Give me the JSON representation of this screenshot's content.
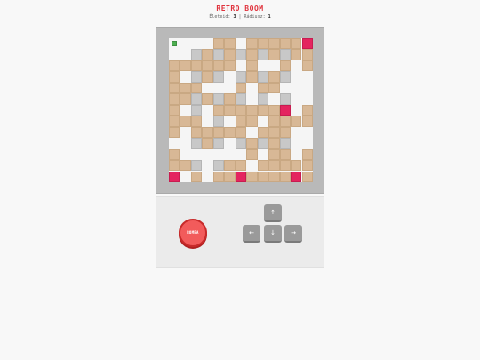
{
  "game": {
    "title": "RETRO BOOM",
    "stats": {
      "lives_label": "Életeid:",
      "lives_value": "3",
      "separator": "|",
      "radius_label": "Rádiusz:",
      "radius_value": "1"
    }
  },
  "board": {
    "size": 13,
    "legend": {
      "B": "breakable-block",
      "W": "wall",
      "E": "enemy",
      "P": "player",
      ".": "empty"
    },
    "colors": {
      "breakable": "#d8b896",
      "wall": "#c8c8c8",
      "enemy": "#e4245f",
      "player": "#4caf50",
      "floor": "#f5f5f5"
    },
    "rows": [
      "P...BB.BBBBBE",
      "..WBWBWBWBWBB",
      "BBBBBB.B..B.B",
      "B.WBW.WBWBW..",
      "BBB...B.BB...",
      "BBWBWBW.W.W..",
      "B.W.BBBBBBE.B",
      "BBB.W.BB.BBBB",
      "B.BBBBB.BBB..",
      "..WBW.WBWBW..",
      "B......B.BB.B",
      "BBW.WBB.BBBBB",
      "E.B.BBEBBBBEB"
    ]
  },
  "controls": {
    "bomb_label": "BOMBA",
    "up_label": "↑",
    "down_label": "↓",
    "left_label": "←",
    "right_label": "→"
  }
}
